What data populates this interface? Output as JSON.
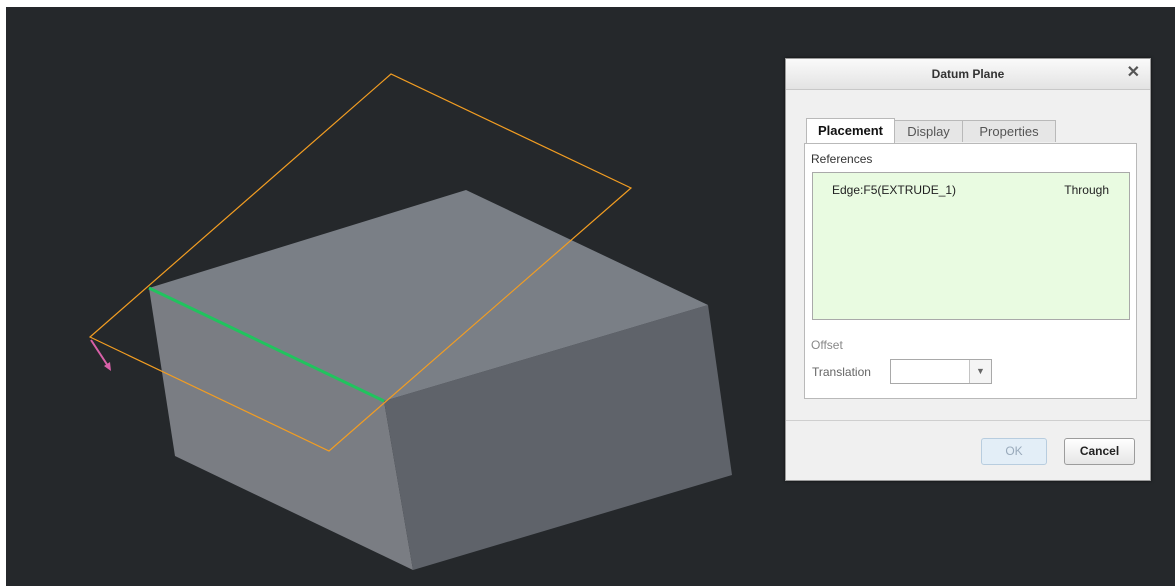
{
  "dialog": {
    "title": "Datum Plane",
    "close_icon": "close-icon",
    "tabs": [
      {
        "label": "Placement",
        "active": true
      },
      {
        "label": "Display",
        "active": false
      },
      {
        "label": "Properties",
        "active": false
      }
    ],
    "references_label": "References",
    "references": [
      {
        "entity": "Edge:F5(EXTRUDE_1)",
        "constraint": "Through"
      }
    ],
    "offset_label": "Offset",
    "translation_label": "Translation",
    "translation_value": "",
    "ok_label": "OK",
    "cancel_label": "Cancel"
  },
  "colors": {
    "viewport_background": "#25282b",
    "model_top_face": "#7a7f86",
    "model_front_face": "#7a7d83",
    "model_right_face": "#5f636a",
    "datum_plane_outline": "#f29d22",
    "selected_edge": "#21c35e",
    "direction_arrow": "#d860a8",
    "reference_box": "#e9fbe1"
  }
}
